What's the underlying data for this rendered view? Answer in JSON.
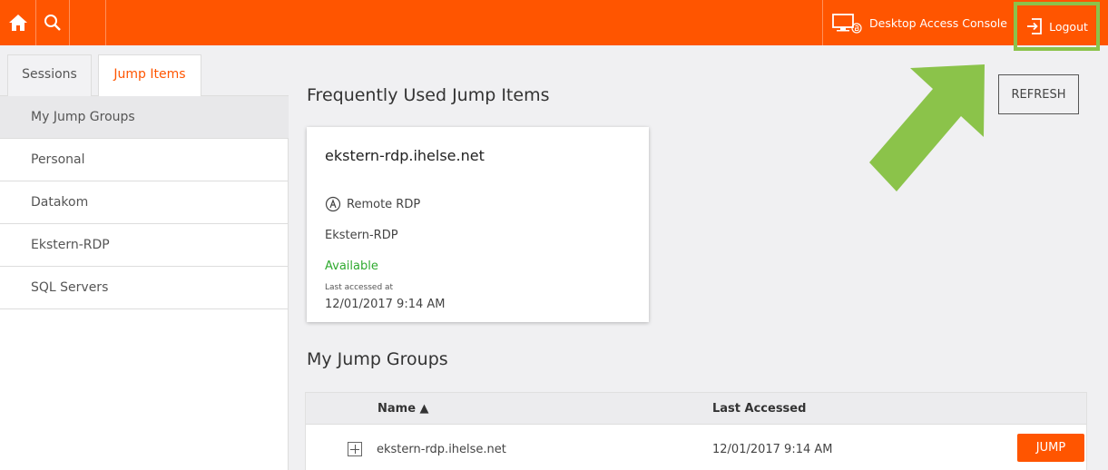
{
  "topbar": {
    "home_icon": "home-icon",
    "search_icon": "search-icon",
    "console_label": "Desktop Access Console",
    "console_icon": "desktop-console-icon",
    "logout_label": "Logout",
    "logout_icon": "logout-icon",
    "accent_color": "#ff5500",
    "highlight_color": "#8bc34a"
  },
  "sidebar": {
    "tabs": [
      {
        "label": "Sessions"
      },
      {
        "label": "Jump Items"
      }
    ],
    "items": [
      {
        "label": "My Jump Groups"
      },
      {
        "label": "Personal"
      },
      {
        "label": "Datakom"
      },
      {
        "label": "Ekstern-RDP"
      },
      {
        "label": "SQL Servers"
      }
    ]
  },
  "main": {
    "frequent_title": "Frequently Used Jump Items",
    "refresh_label": "REFRESH",
    "card": {
      "title": "ekstern-rdp.ihelse.net",
      "type": "Remote RDP",
      "group": "Ekstern-RDP",
      "status": "Available",
      "last_accessed_label": "Last accessed at",
      "last_accessed": "12/01/2017 9:14 AM"
    },
    "groups_title": "My Jump Groups",
    "table": {
      "col_name": "Name ▲",
      "col_last": "Last Accessed",
      "rows": [
        {
          "name": "ekstern-rdp.ihelse.net",
          "last": "12/01/2017 9:14 AM",
          "action": "JUMP"
        }
      ]
    }
  }
}
